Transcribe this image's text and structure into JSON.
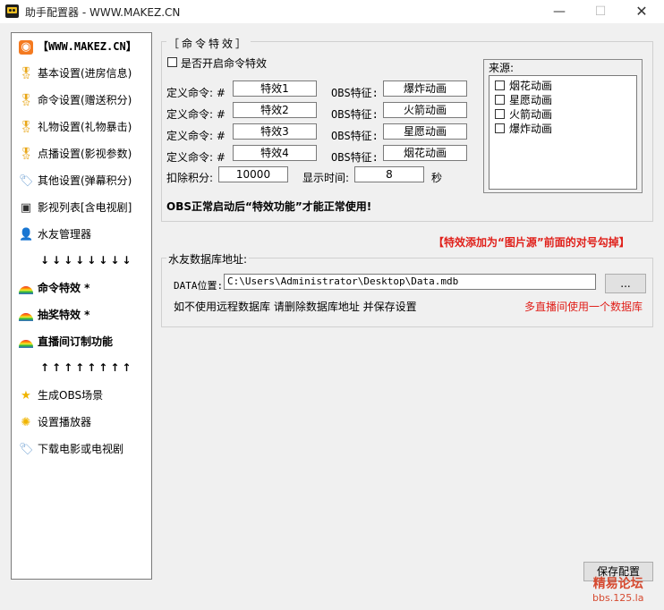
{
  "window": {
    "title": "助手配置器 - WWW.MAKEZ.CN",
    "min": "—",
    "max": "☐",
    "close": "✕"
  },
  "sidebar": {
    "items": [
      {
        "label": "【WWW.MAKEZ.CN】",
        "icon": "rss-icon"
      },
      {
        "label": "基本设置(进房信息)",
        "icon": "medal-icon"
      },
      {
        "label": "命令设置(赠送积分)",
        "icon": "medal-icon"
      },
      {
        "label": "礼物设置(礼物暴击)",
        "icon": "medal-icon"
      },
      {
        "label": "点播设置(影视参数)",
        "icon": "medal-icon"
      },
      {
        "label": "其他设置(弹幕积分)",
        "icon": "tag-icon"
      },
      {
        "label": "影视列表[含电视剧]",
        "icon": "film-icon"
      },
      {
        "label": "水友管理器",
        "icon": "user-icon"
      },
      {
        "label": "命令特效 *",
        "icon": "rainbow-icon"
      },
      {
        "label": "抽奖特效 *",
        "icon": "rainbow-icon"
      },
      {
        "label": "直播间订制功能",
        "icon": "rainbow-icon"
      },
      {
        "label": "生成OBS场景",
        "icon": "star-icon"
      },
      {
        "label": "设置播放器",
        "icon": "sparkle-icon"
      },
      {
        "label": "下载电影或电视剧",
        "icon": "tag-icon"
      }
    ],
    "arrows_down": "↓↓↓↓↓↓↓↓",
    "arrows_up": "↑↑↑↑↑↑↑↑"
  },
  "effects": {
    "group_title": "［命令特效］",
    "enable_label": "是否开启命令特效",
    "rows": [
      {
        "cmd_label": "定义命令: #",
        "cmd_value": "特效1",
        "obs_label": "OBS特征:",
        "obs_value": "爆炸动画"
      },
      {
        "cmd_label": "定义命令: #",
        "cmd_value": "特效2",
        "obs_label": "OBS特征:",
        "obs_value": "火箭动画"
      },
      {
        "cmd_label": "定义命令: #",
        "cmd_value": "特效3",
        "obs_label": "OBS特征:",
        "obs_value": "星愿动画"
      },
      {
        "cmd_label": "定义命令: #",
        "cmd_value": "特效4",
        "obs_label": "OBS特征:",
        "obs_value": "烟花动画"
      }
    ],
    "deduct_label": "扣除积分:",
    "deduct_value": "10000",
    "time_label": "显示时间:",
    "time_value": "8",
    "time_unit": "秒",
    "notice": "OBS正常启动后“特效功能”才能正常使用!",
    "source_title": "来源:",
    "sources": [
      "烟花动画",
      "星愿动画",
      "火箭动画",
      "爆炸动画"
    ],
    "hint": "【特效添加为“图片源”前面的对号勾掉】"
  },
  "db": {
    "group_title": "水友数据库地址:",
    "path_label": "DATA位置:",
    "path_value": "C:\\Users\\Administrator\\Desktop\\Data.mdb",
    "browse": "...",
    "note": "如不使用远程数据库 请删除数据库地址 并保存设置",
    "note_red": "多直播间使用一个数据库"
  },
  "save_button": "保存配置",
  "watermark": {
    "line1": "精易论坛",
    "line2": "bbs.125.la"
  },
  "colors": {
    "accent_red": "#e0201a"
  }
}
